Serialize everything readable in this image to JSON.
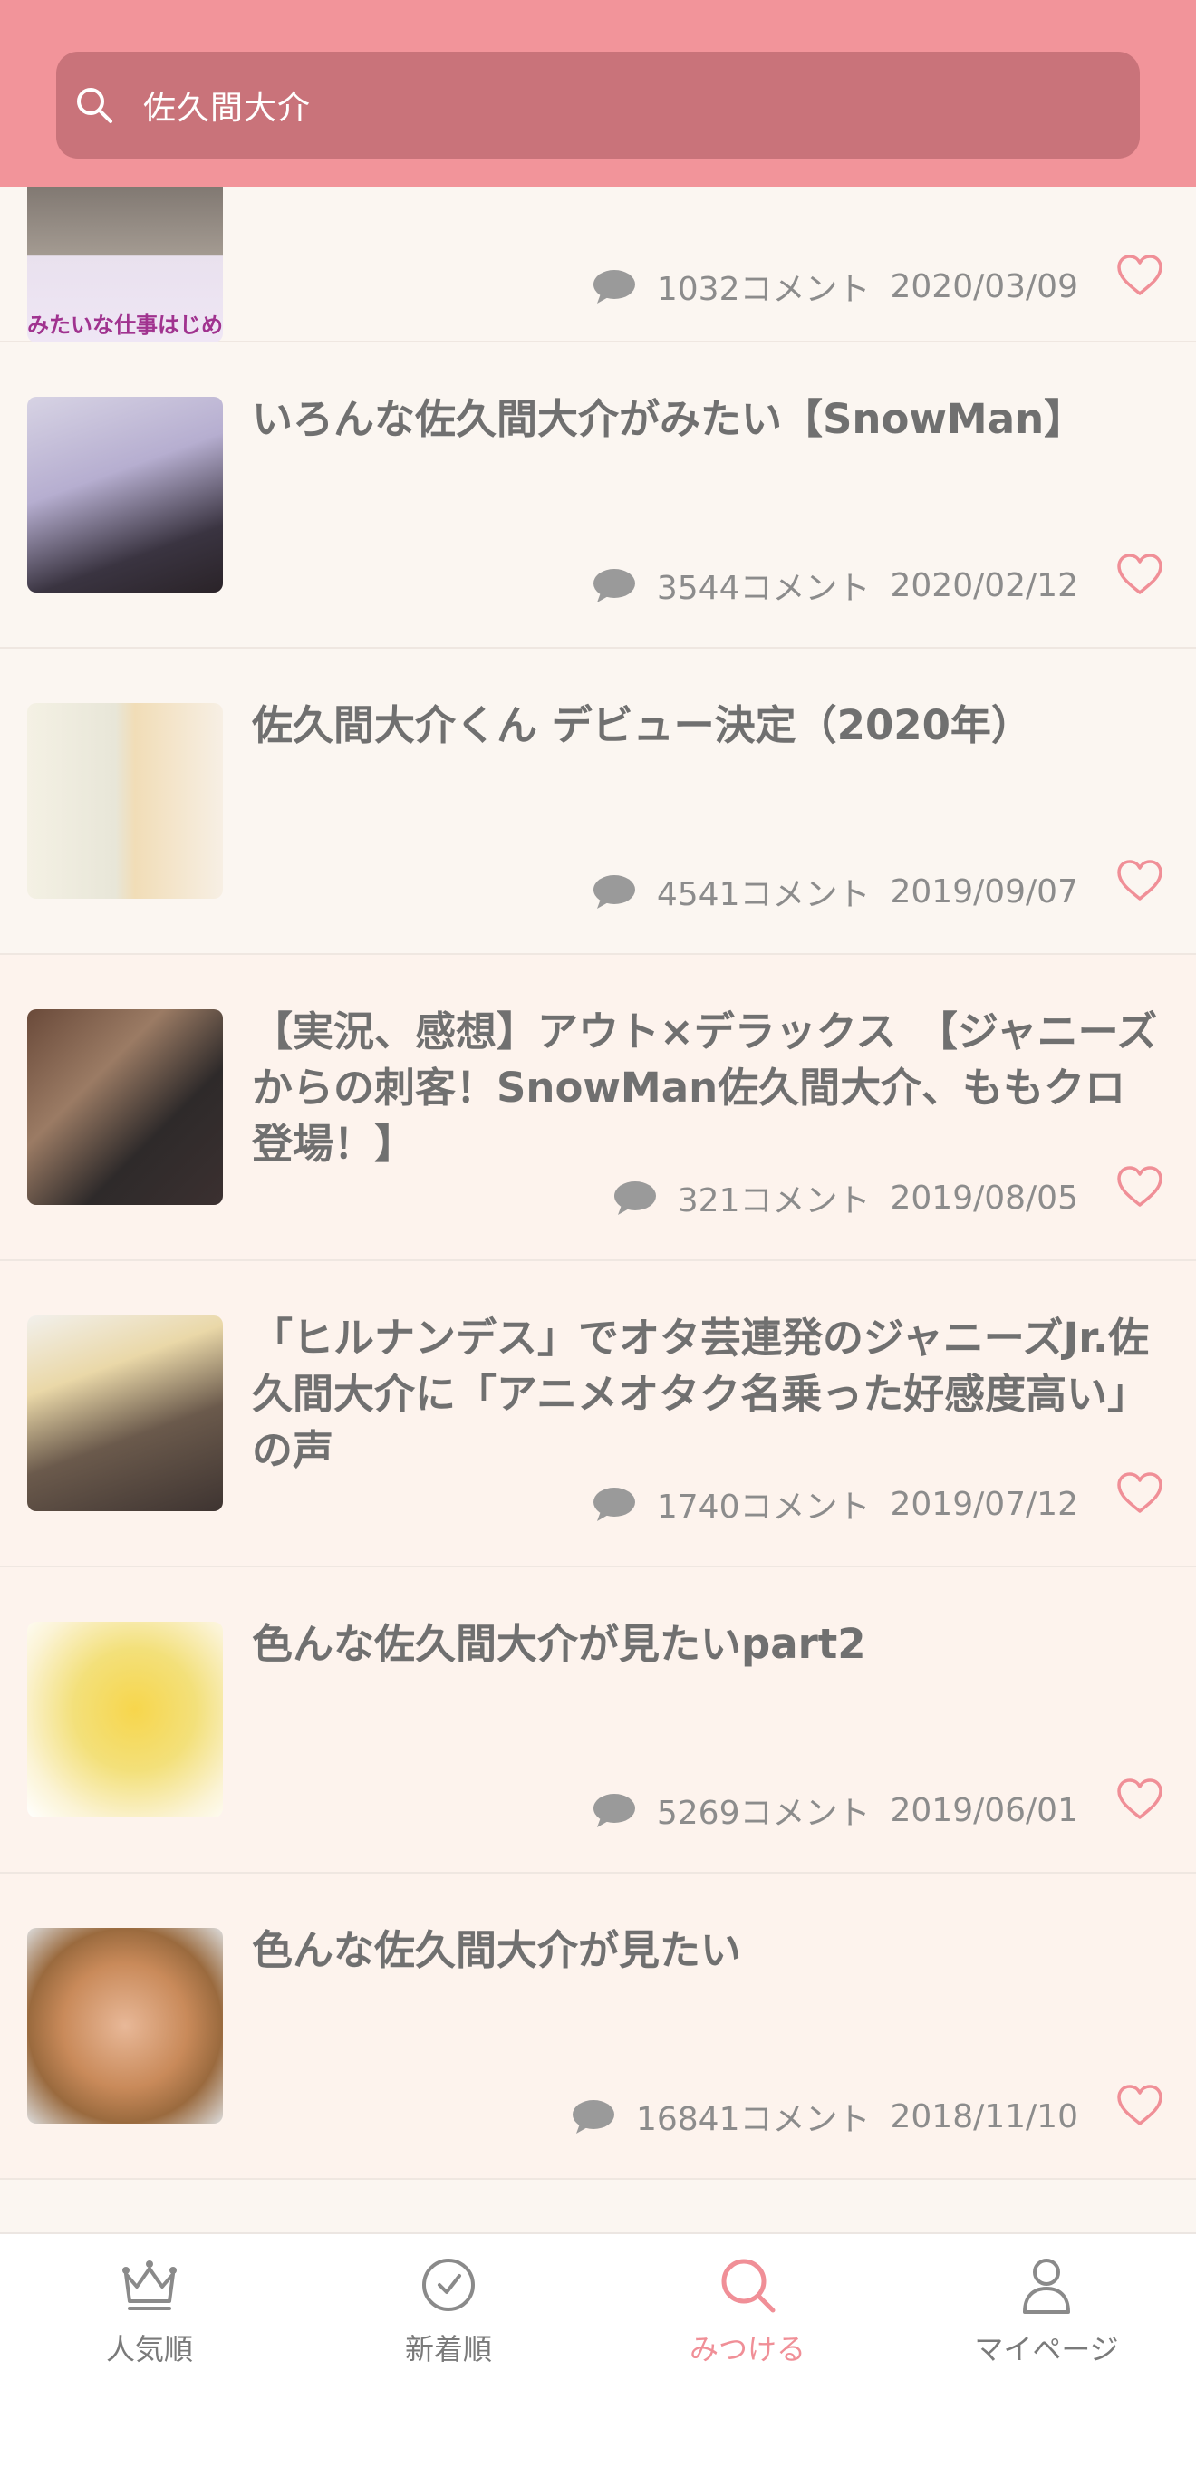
{
  "search": {
    "query": "佐久間大介"
  },
  "items": [
    {
      "title": "",
      "comments": "1032コメント",
      "date": "2020/03/09",
      "thumb_text": "みたいな仕事はじめ"
    },
    {
      "title": "いろんな佐久間大介がみたい【SnowMan】",
      "comments": "3544コメント",
      "date": "2020/02/12"
    },
    {
      "title": "佐久間大介くん デビュー決定（2020年）",
      "comments": "4541コメント",
      "date": "2019/09/07"
    },
    {
      "title": "【実況、感想】アウト×デラックス　【ジャニーズからの刺客！SnowMan佐久間大介、ももクロ登場！】",
      "comments": "321コメント",
      "date": "2019/08/05"
    },
    {
      "title": "「ヒルナンデス」でオタ芸連発のジャニーズJr.佐久間大介に「アニメオタク名乗った好感度高い」の声",
      "comments": "1740コメント",
      "date": "2019/07/12"
    },
    {
      "title": "色んな佐久間大介が見たいpart2",
      "comments": "5269コメント",
      "date": "2019/06/01"
    },
    {
      "title": "色んな佐久間大介が見たい",
      "comments": "16841コメント",
      "date": "2018/11/10"
    }
  ],
  "tabs": [
    {
      "label": "人気順",
      "icon": "crown-icon"
    },
    {
      "label": "新着順",
      "icon": "clock-icon"
    },
    {
      "label": "みつける",
      "icon": "search-icon",
      "active": true
    },
    {
      "label": "マイページ",
      "icon": "person-icon"
    }
  ],
  "colors": {
    "header": "#f2949a",
    "search_box": "#c9737a",
    "accent": "#f08f97"
  }
}
